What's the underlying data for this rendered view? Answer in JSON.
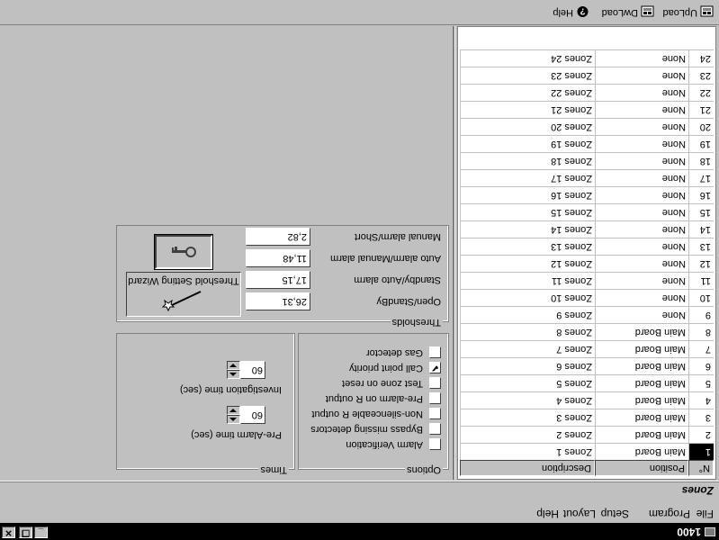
{
  "titlebar": {
    "title": "1400",
    "minimize": "_",
    "restore": "❐",
    "close": "✕"
  },
  "menu": [
    {
      "label": "File"
    },
    {
      "label": "Program"
    },
    {
      "label": "Setup"
    },
    {
      "label": "Layout"
    },
    {
      "label": "Help"
    }
  ],
  "section": {
    "title": "Zones"
  },
  "table": {
    "columns": [
      "N°",
      "Position",
      "Description"
    ],
    "rows": [
      {
        "n": "1",
        "position": "Main Board",
        "description": "Zones 1"
      },
      {
        "n": "2",
        "position": "Main Board",
        "description": "Zones 2"
      },
      {
        "n": "3",
        "position": "Main Board",
        "description": "Zones 3"
      },
      {
        "n": "4",
        "position": "Main Board",
        "description": "Zones 4"
      },
      {
        "n": "5",
        "position": "Main Board",
        "description": "Zones 5"
      },
      {
        "n": "6",
        "position": "Main Board",
        "description": "Zones 6"
      },
      {
        "n": "7",
        "position": "Main Board",
        "description": "Zones 7"
      },
      {
        "n": "8",
        "position": "Main Board",
        "description": "Zones 8"
      },
      {
        "n": "9",
        "position": "None",
        "description": "Zones 9"
      },
      {
        "n": "10",
        "position": "None",
        "description": "Zones 10"
      },
      {
        "n": "11",
        "position": "None",
        "description": "Zones 11"
      },
      {
        "n": "12",
        "position": "None",
        "description": "Zones 12"
      },
      {
        "n": "13",
        "position": "None",
        "description": "Zones 13"
      },
      {
        "n": "14",
        "position": "None",
        "description": "Zones 14"
      },
      {
        "n": "15",
        "position": "None",
        "description": "Zones 15"
      },
      {
        "n": "16",
        "position": "None",
        "description": "Zones 16"
      },
      {
        "n": "17",
        "position": "None",
        "description": "Zones 17"
      },
      {
        "n": "18",
        "position": "None",
        "description": "Zones 18"
      },
      {
        "n": "19",
        "position": "None",
        "description": "Zones 19"
      },
      {
        "n": "20",
        "position": "None",
        "description": "Zones 20"
      },
      {
        "n": "21",
        "position": "None",
        "description": "Zones 21"
      },
      {
        "n": "22",
        "position": "None",
        "description": "Zones 22"
      },
      {
        "n": "23",
        "position": "None",
        "description": "Zones 23"
      },
      {
        "n": "24",
        "position": "None",
        "description": "Zones 24"
      }
    ]
  },
  "options": {
    "title": "Options",
    "items": [
      {
        "label": "Alarm Verification",
        "checked": false
      },
      {
        "label": "Bypass missing detectors",
        "checked": false
      },
      {
        "label": "Non-silenceable R output",
        "checked": false
      },
      {
        "label": "Pre-alarm on R output",
        "checked": false
      },
      {
        "label": "Test zone on reset",
        "checked": false
      },
      {
        "label": "Call point priority",
        "checked": true
      },
      {
        "label": "Gas detector",
        "checked": false
      }
    ]
  },
  "times": {
    "title": "Times",
    "prealarm_label": "Pre-Alarm time (sec)",
    "prealarm_value": "60",
    "investigation_label": "Investigation time (sec)",
    "investigation_value": "60"
  },
  "thresholds": {
    "title": "Thresholds",
    "items": [
      {
        "label": "Open/StandBy",
        "value": "26,31"
      },
      {
        "label": "Standby/Auto alarm",
        "value": "17,15"
      },
      {
        "label": "Auto alarm/Manual alarm",
        "value": "11,48"
      },
      {
        "label": "Manual alarm/Short",
        "value": "2,82"
      }
    ],
    "wizard_label": "Threshold Setting Wizard"
  },
  "toolbar": [
    {
      "label": "UpLoad"
    },
    {
      "label": "DwLoad"
    },
    {
      "label": "Help"
    }
  ]
}
